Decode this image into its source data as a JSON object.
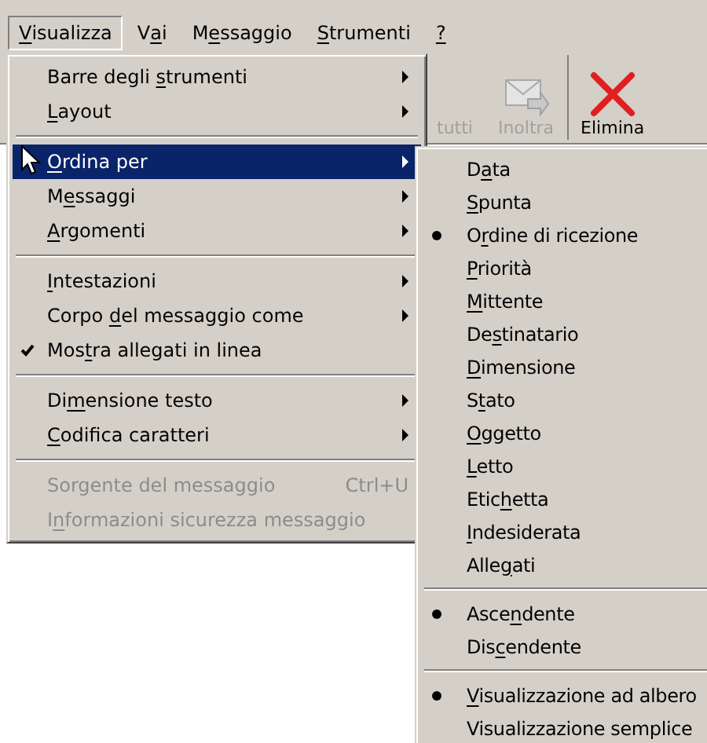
{
  "menubar": [
    {
      "key": "V",
      "post": "isualizza",
      "selected": true
    },
    {
      "pre": "V",
      "key": "a",
      "post": "i",
      "selected": false
    },
    {
      "pre": "M",
      "key": "e",
      "post": "ssaggio",
      "selected": false
    },
    {
      "key": "S",
      "post": "trumenti",
      "selected": false
    },
    {
      "key": "?",
      "selected": false
    }
  ],
  "toolbar": [
    {
      "kind": "text",
      "label": "tutti",
      "disabled": true
    },
    {
      "kind": "forward",
      "label": "Inoltra",
      "disabled": true
    },
    {
      "kind": "delete",
      "label": "Elimina",
      "disabled": false
    }
  ],
  "menu": {
    "items": [
      {
        "kind": "item",
        "pre": "Barre degli ",
        "key": "s",
        "post": "trumenti",
        "submenu": true,
        "checked": false,
        "highlighted": false,
        "disabled": false
      },
      {
        "kind": "item",
        "key": "L",
        "post": "ayout",
        "submenu": true,
        "checked": false,
        "highlighted": false,
        "disabled": false
      },
      {
        "kind": "separator"
      },
      {
        "kind": "item",
        "key": "O",
        "post": "rdina per",
        "submenu": true,
        "checked": false,
        "highlighted": true,
        "disabled": false
      },
      {
        "kind": "item",
        "pre": "M",
        "key": "e",
        "post": "ssaggi",
        "submenu": true,
        "checked": false,
        "highlighted": false,
        "disabled": false
      },
      {
        "kind": "item",
        "key": "A",
        "post": "rgomenti",
        "submenu": true,
        "checked": false,
        "highlighted": false,
        "disabled": false
      },
      {
        "kind": "separator"
      },
      {
        "kind": "item",
        "key": "I",
        "post": "ntestazioni",
        "submenu": true,
        "checked": false,
        "highlighted": false,
        "disabled": false
      },
      {
        "kind": "item",
        "pre": "Corpo ",
        "key": "d",
        "post": "el messaggio come",
        "submenu": true,
        "checked": false,
        "highlighted": false,
        "disabled": false
      },
      {
        "kind": "item",
        "pre": "Mos",
        "key": "t",
        "post": "ra allegati in linea",
        "submenu": false,
        "checked": true,
        "highlighted": false,
        "disabled": false
      },
      {
        "kind": "separator"
      },
      {
        "kind": "item",
        "pre": "Di",
        "key": "m",
        "post": "ensione testo",
        "submenu": true,
        "checked": false,
        "highlighted": false,
        "disabled": false
      },
      {
        "kind": "item",
        "key": "C",
        "post": "odifica caratteri",
        "submenu": true,
        "checked": false,
        "highlighted": false,
        "disabled": false
      },
      {
        "kind": "separator"
      },
      {
        "kind": "item",
        "pre": "Sorgente del messaggio",
        "shortcut": "Ctrl+U",
        "submenu": false,
        "checked": false,
        "highlighted": false,
        "disabled": true
      },
      {
        "kind": "item",
        "pre": "I",
        "key": "n",
        "post": "formazioni sicurezza messaggio",
        "submenu": false,
        "checked": false,
        "highlighted": false,
        "disabled": true
      }
    ]
  },
  "submenu": {
    "items": [
      {
        "kind": "item",
        "pre": "D",
        "key": "a",
        "post": "ta",
        "selected": false
      },
      {
        "kind": "item",
        "key": "S",
        "post": "punta",
        "selected": false
      },
      {
        "kind": "item",
        "pre": "O",
        "key": "r",
        "post": "dine di ricezione",
        "selected": true
      },
      {
        "kind": "item",
        "key": "P",
        "post": "riorità",
        "selected": false
      },
      {
        "kind": "item",
        "key": "M",
        "post": "ittente",
        "selected": false
      },
      {
        "kind": "item",
        "pre": "De",
        "key": "s",
        "post": "tinatario",
        "selected": false
      },
      {
        "kind": "item",
        "key": "D",
        "post": "imensione",
        "selected": false
      },
      {
        "kind": "item",
        "pre": "S",
        "key": "t",
        "post": "ato",
        "selected": false
      },
      {
        "kind": "item",
        "key": "O",
        "post": "ggetto",
        "selected": false
      },
      {
        "kind": "item",
        "key": "L",
        "post": "etto",
        "selected": false
      },
      {
        "kind": "item",
        "pre": "Etic",
        "key": "h",
        "post": "etta",
        "selected": false
      },
      {
        "kind": "item",
        "key": "I",
        "post": "ndesiderata",
        "selected": false
      },
      {
        "kind": "item",
        "pre": "Alle",
        "key": "g",
        "post": "ati",
        "selected": false
      },
      {
        "kind": "separator"
      },
      {
        "kind": "item",
        "pre": "Asce",
        "key": "n",
        "post": "dente",
        "selected": true
      },
      {
        "kind": "item",
        "pre": "Dis",
        "key": "c",
        "post": "endente",
        "selected": false
      },
      {
        "kind": "separator"
      },
      {
        "kind": "item",
        "key": "V",
        "post": "isualizzazione ad albero",
        "selected": true
      },
      {
        "kind": "item",
        "pre": "Visualizzazione semplice",
        "selected": false
      }
    ]
  }
}
